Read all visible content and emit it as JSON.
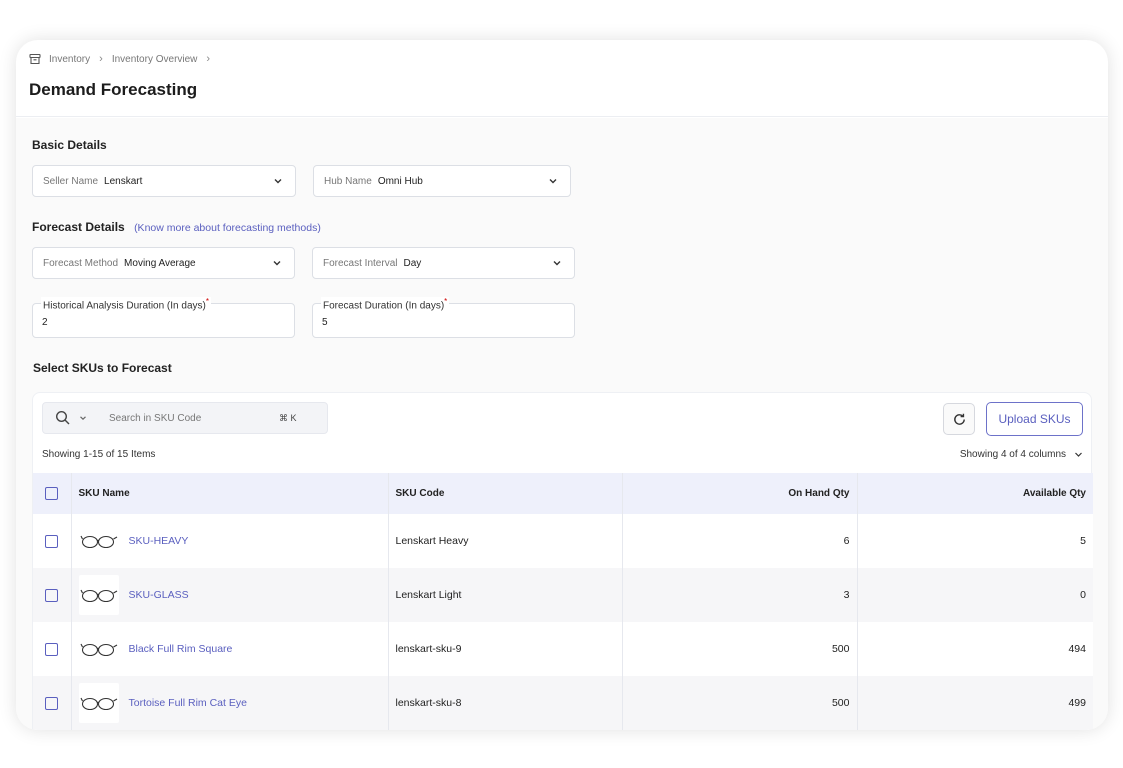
{
  "breadcrumb": {
    "items": [
      "Inventory",
      "Inventory Overview"
    ]
  },
  "page_title": "Demand Forecasting",
  "basic_details": {
    "title": "Basic Details",
    "seller": {
      "label": "Seller Name",
      "value": "Lenskart"
    },
    "hub": {
      "label": "Hub Name",
      "value": "Omni Hub"
    }
  },
  "forecast_details": {
    "title": "Forecast Details",
    "link": "(Know more about forecasting methods)",
    "method": {
      "label": "Forecast Method",
      "value": "Moving Average"
    },
    "interval": {
      "label": "Forecast Interval",
      "value": "Day"
    },
    "historical": {
      "label": "Historical Analysis Duration (In days)",
      "required": "*",
      "value": "2"
    },
    "duration": {
      "label": "Forecast Duration (In days)",
      "required": "*",
      "value": "5"
    }
  },
  "sku_section": {
    "title": "Select SKUs to Forecast",
    "search_placeholder": "Search in SKU Code",
    "shortcut": "⌘ K",
    "upload_label": "Upload SKUs",
    "showing_items": "Showing 1-15 of 15 Items",
    "showing_columns": "Showing 4 of 4 columns",
    "columns": {
      "name": "SKU Name",
      "code": "SKU Code",
      "on_hand": "On Hand Qty",
      "available": "Available Qty"
    },
    "rows": [
      {
        "name": "SKU-HEAVY",
        "code": "Lenskart Heavy",
        "on_hand": "6",
        "available": "5"
      },
      {
        "name": "SKU-GLASS",
        "code": "Lenskart Light",
        "on_hand": "3",
        "available": "0"
      },
      {
        "name": "Black Full Rim Square",
        "code": "lenskart-sku-9",
        "on_hand": "500",
        "available": "494"
      },
      {
        "name": "Tortoise Full Rim Cat Eye",
        "code": "lenskart-sku-8",
        "on_hand": "500",
        "available": "499"
      }
    ]
  },
  "colors": {
    "accent": "#5a5fbf",
    "header_row": "#eef0fb"
  }
}
